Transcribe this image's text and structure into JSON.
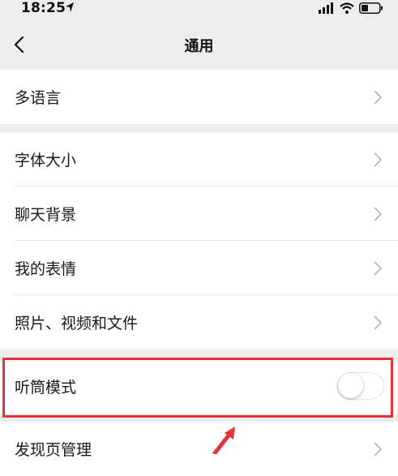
{
  "status": {
    "time": "18:25",
    "icons": [
      "location-arrow-icon",
      "signal-icon",
      "wifi-icon",
      "battery-icon"
    ]
  },
  "nav": {
    "title": "通用",
    "back_icon": "chevron-left-icon"
  },
  "groups": [
    {
      "items": [
        {
          "label": "多语言",
          "type": "chevron"
        }
      ]
    },
    {
      "items": [
        {
          "label": "字体大小",
          "type": "chevron"
        },
        {
          "label": "聊天背景",
          "type": "chevron"
        },
        {
          "label": "我的表情",
          "type": "chevron"
        },
        {
          "label": "照片、视频和文件",
          "type": "chevron"
        }
      ]
    },
    {
      "items": [
        {
          "label": "听筒模式",
          "type": "toggle",
          "toggle_on": false
        }
      ]
    },
    {
      "items": [
        {
          "label": "发现页管理",
          "type": "chevron"
        }
      ]
    }
  ],
  "annotation": {
    "highlight_color": "#e5333a",
    "target": "听筒模式"
  }
}
